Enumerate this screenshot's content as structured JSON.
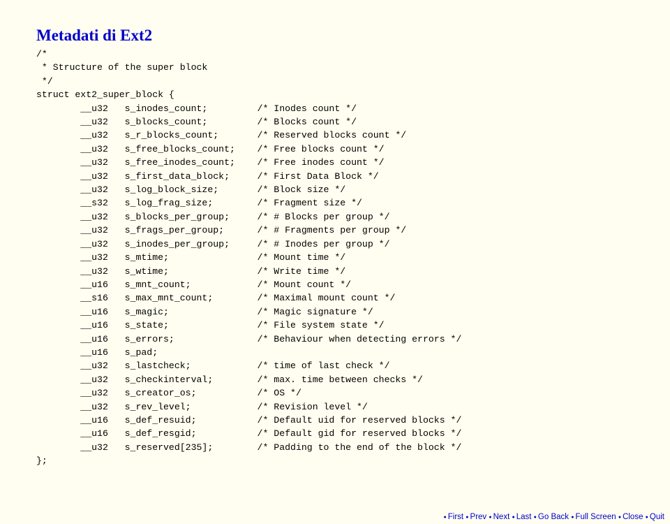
{
  "title": "Metadati di Ext2",
  "code_lines": [
    "/*",
    " * Structure of the super block",
    " */",
    "struct ext2_super_block {",
    "        __u32   s_inodes_count;         /* Inodes count */",
    "        __u32   s_blocks_count;         /* Blocks count */",
    "        __u32   s_r_blocks_count;       /* Reserved blocks count */",
    "        __u32   s_free_blocks_count;    /* Free blocks count */",
    "        __u32   s_free_inodes_count;    /* Free inodes count */",
    "        __u32   s_first_data_block;     /* First Data Block */",
    "        __u32   s_log_block_size;       /* Block size */",
    "        __s32   s_log_frag_size;        /* Fragment size */",
    "        __u32   s_blocks_per_group;     /* # Blocks per group */",
    "        __u32   s_frags_per_group;      /* # Fragments per group */",
    "        __u32   s_inodes_per_group;     /* # Inodes per group */",
    "        __u32   s_mtime;                /* Mount time */",
    "        __u32   s_wtime;                /* Write time */",
    "        __u16   s_mnt_count;            /* Mount count */",
    "        __s16   s_max_mnt_count;        /* Maximal mount count */",
    "        __u16   s_magic;                /* Magic signature */",
    "        __u16   s_state;                /* File system state */",
    "        __u16   s_errors;               /* Behaviour when detecting errors */",
    "        __u16   s_pad;",
    "        __u32   s_lastcheck;            /* time of last check */",
    "        __u32   s_checkinterval;        /* max. time between checks */",
    "        __u32   s_creator_os;           /* OS */",
    "        __u32   s_rev_level;            /* Revision level */",
    "        __u16   s_def_resuid;           /* Default uid for reserved blocks */",
    "        __u16   s_def_resgid;           /* Default gid for reserved blocks */",
    "        __u32   s_reserved[235];        /* Padding to the end of the block */",
    "};"
  ],
  "footer": {
    "items": [
      "First",
      "Prev",
      "Next",
      "Last",
      "Go Back",
      "Full Screen",
      "Close",
      "Quit"
    ]
  }
}
